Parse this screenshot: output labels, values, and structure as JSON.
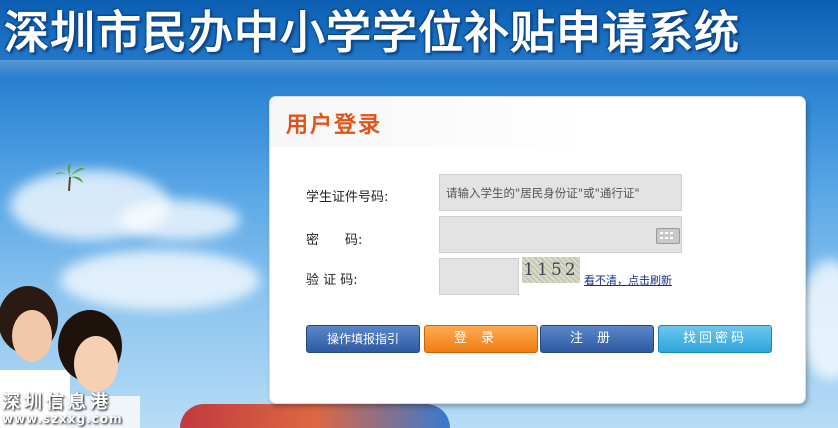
{
  "banner": {
    "title": "深圳市民办中小学学位补贴申请系统"
  },
  "watermark": {
    "line1": "深圳信息港",
    "line2": "www.szxxg.com"
  },
  "login": {
    "title": "用户登录",
    "student_id_label": "学生证件号码:",
    "student_id_placeholder": "请输入学生的\"居民身份证\"或\"通行证\"",
    "password_label": "密　　码:",
    "captcha_label": "验 证 码:",
    "captcha_text": "1152",
    "refresh_link": "看不清，点击刷新",
    "buttons": {
      "guide": "操作填报指引",
      "login": "登录",
      "register": "注册",
      "recover": "找回密码"
    }
  },
  "colors": {
    "accent": "#e2531a",
    "login_button": "#f07d12",
    "primary_button": "#2f5aa3",
    "recover_button": "#2ea4dc"
  }
}
